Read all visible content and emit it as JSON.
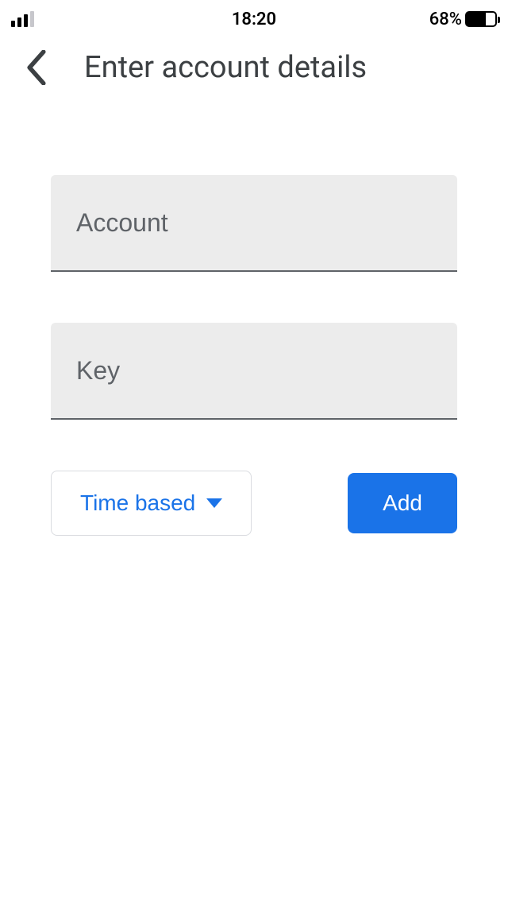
{
  "status_bar": {
    "time": "18:20",
    "battery_pct": "68%"
  },
  "header": {
    "title": "Enter account details"
  },
  "form": {
    "account_placeholder": "Account",
    "key_placeholder": "Key",
    "type_select_label": "Time based",
    "add_button_label": "Add"
  },
  "colors": {
    "accent": "#1a73e8",
    "field_bg": "#ececec",
    "text_muted": "#5f6368"
  }
}
